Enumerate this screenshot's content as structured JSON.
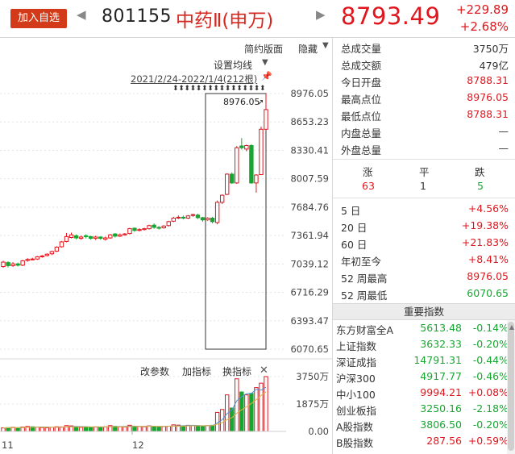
{
  "header": {
    "add_button": "加入自选",
    "prev_arrow": "◀",
    "next_arrow": "▶",
    "code": "801155",
    "name": "中药Ⅱ(申万)",
    "price": "8793.49",
    "change_abs": "+229.89",
    "change_pct": "+2.68%"
  },
  "chart": {
    "simple_layout": "简约版面",
    "hide": "隐藏",
    "set_ma": "设置均线",
    "date_range": "2021/2/24-2022/1/4(212根)",
    "max_marker": "8976.05",
    "y_ticks": [
      "8976.05",
      "8653.23",
      "8330.41",
      "8007.59",
      "7684.76",
      "7361.94",
      "7039.12",
      "6716.29",
      "6393.47",
      "6070.65"
    ],
    "vol_toolbar": {
      "params": "改参数",
      "indicator": "加指标",
      "switch": "换指标",
      "close": "✕"
    },
    "vol_ticks": [
      "3750万",
      "1875万",
      "0.00"
    ],
    "x_ticks": [
      "11",
      "12"
    ]
  },
  "chart_data": {
    "type": "candlestick",
    "ylim": [
      6070.65,
      8976.05
    ],
    "candles": [
      {
        "o": 7010,
        "c": 7060,
        "h": 7075,
        "l": 6995
      },
      {
        "o": 7055,
        "c": 7020,
        "h": 7070,
        "l": 7000
      },
      {
        "o": 7020,
        "c": 7040,
        "h": 7060,
        "l": 7005
      },
      {
        "o": 7040,
        "c": 7025,
        "h": 7055,
        "l": 7010
      },
      {
        "o": 7025,
        "c": 7075,
        "h": 7085,
        "l": 7015
      },
      {
        "o": 7080,
        "c": 7090,
        "h": 7105,
        "l": 7065
      },
      {
        "o": 7095,
        "c": 7095,
        "h": 7110,
        "l": 7080
      },
      {
        "o": 7095,
        "c": 7120,
        "h": 7130,
        "l": 7085
      },
      {
        "o": 7125,
        "c": 7130,
        "h": 7140,
        "l": 7110
      },
      {
        "o": 7135,
        "c": 7150,
        "h": 7160,
        "l": 7125
      },
      {
        "o": 7155,
        "c": 7180,
        "h": 7190,
        "l": 7140
      },
      {
        "o": 7185,
        "c": 7230,
        "h": 7240,
        "l": 7175
      },
      {
        "o": 7235,
        "c": 7290,
        "h": 7300,
        "l": 7225
      },
      {
        "o": 7295,
        "c": 7350,
        "h": 7390,
        "l": 7285
      },
      {
        "o": 7340,
        "c": 7370,
        "h": 7395,
        "l": 7330
      },
      {
        "o": 7360,
        "c": 7335,
        "h": 7375,
        "l": 7320
      },
      {
        "o": 7330,
        "c": 7345,
        "h": 7360,
        "l": 7315
      },
      {
        "o": 7360,
        "c": 7350,
        "h": 7375,
        "l": 7330
      },
      {
        "o": 7350,
        "c": 7330,
        "h": 7360,
        "l": 7315
      },
      {
        "o": 7330,
        "c": 7345,
        "h": 7360,
        "l": 7310
      },
      {
        "o": 7345,
        "c": 7330,
        "h": 7355,
        "l": 7315
      },
      {
        "o": 7320,
        "c": 7335,
        "h": 7350,
        "l": 7305
      },
      {
        "o": 7335,
        "c": 7370,
        "h": 7380,
        "l": 7325
      },
      {
        "o": 7380,
        "c": 7355,
        "h": 7390,
        "l": 7340
      },
      {
        "o": 7355,
        "c": 7370,
        "h": 7385,
        "l": 7345
      },
      {
        "o": 7370,
        "c": 7380,
        "h": 7390,
        "l": 7360
      },
      {
        "o": 7385,
        "c": 7440,
        "h": 7450,
        "l": 7375
      },
      {
        "o": 7445,
        "c": 7420,
        "h": 7455,
        "l": 7405
      },
      {
        "o": 7420,
        "c": 7430,
        "h": 7445,
        "l": 7410
      },
      {
        "o": 7430,
        "c": 7440,
        "h": 7450,
        "l": 7420
      },
      {
        "o": 7440,
        "c": 7475,
        "h": 7485,
        "l": 7430
      },
      {
        "o": 7480,
        "c": 7455,
        "h": 7500,
        "l": 7440
      },
      {
        "o": 7455,
        "c": 7445,
        "h": 7470,
        "l": 7430
      },
      {
        "o": 7450,
        "c": 7470,
        "h": 7480,
        "l": 7440
      },
      {
        "o": 7475,
        "c": 7520,
        "h": 7530,
        "l": 7465
      },
      {
        "o": 7525,
        "c": 7560,
        "h": 7575,
        "l": 7515
      },
      {
        "o": 7565,
        "c": 7570,
        "h": 7590,
        "l": 7550
      },
      {
        "o": 7570,
        "c": 7560,
        "h": 7590,
        "l": 7545
      },
      {
        "o": 7560,
        "c": 7585,
        "h": 7595,
        "l": 7550
      },
      {
        "o": 7590,
        "c": 7600,
        "h": 7610,
        "l": 7575
      },
      {
        "o": 7595,
        "c": 7565,
        "h": 7610,
        "l": 7550
      },
      {
        "o": 7565,
        "c": 7540,
        "h": 7575,
        "l": 7520
      },
      {
        "o": 7540,
        "c": 7560,
        "h": 7570,
        "l": 7530
      },
      {
        "o": 7560,
        "c": 7520,
        "h": 7575,
        "l": 7500
      },
      {
        "o": 7510,
        "c": 7740,
        "h": 7760,
        "l": 7490
      },
      {
        "o": 7740,
        "c": 7820,
        "h": 7830,
        "l": 7720
      },
      {
        "o": 7830,
        "c": 8060,
        "h": 8070,
        "l": 7820
      },
      {
        "o": 8060,
        "c": 7960,
        "h": 8080,
        "l": 7950
      },
      {
        "o": 7960,
        "c": 8360,
        "h": 8380,
        "l": 7950
      },
      {
        "o": 8380,
        "c": 8360,
        "h": 8470,
        "l": 8340
      },
      {
        "o": 8345,
        "c": 8385,
        "h": 8395,
        "l": 8320
      },
      {
        "o": 8385,
        "c": 7960,
        "h": 8400,
        "l": 7950
      },
      {
        "o": 7960,
        "c": 8050,
        "h": 8060,
        "l": 7850
      },
      {
        "o": 8055,
        "c": 8570,
        "h": 8600,
        "l": 8050
      },
      {
        "o": 8570,
        "c": 8793.49,
        "h": 8976.05,
        "l": 8560
      }
    ],
    "volumes": [
      {
        "v": 240,
        "up": true
      },
      {
        "v": 260,
        "up": false
      },
      {
        "v": 280,
        "up": true
      },
      {
        "v": 250,
        "up": false
      },
      {
        "v": 300,
        "up": true
      },
      {
        "v": 340,
        "up": true
      },
      {
        "v": 320,
        "up": false
      },
      {
        "v": 300,
        "up": true
      },
      {
        "v": 260,
        "up": true
      },
      {
        "v": 250,
        "up": true
      },
      {
        "v": 280,
        "up": true
      },
      {
        "v": 320,
        "up": true
      },
      {
        "v": 310,
        "up": true
      },
      {
        "v": 400,
        "up": true
      },
      {
        "v": 380,
        "up": true
      },
      {
        "v": 300,
        "up": false
      },
      {
        "v": 280,
        "up": true
      },
      {
        "v": 300,
        "up": false
      },
      {
        "v": 290,
        "up": false
      },
      {
        "v": 310,
        "up": true
      },
      {
        "v": 300,
        "up": false
      },
      {
        "v": 310,
        "up": true
      },
      {
        "v": 400,
        "up": true
      },
      {
        "v": 350,
        "up": false
      },
      {
        "v": 320,
        "up": true
      },
      {
        "v": 300,
        "up": true
      },
      {
        "v": 420,
        "up": true
      },
      {
        "v": 360,
        "up": false
      },
      {
        "v": 340,
        "up": true
      },
      {
        "v": 320,
        "up": true
      },
      {
        "v": 380,
        "up": true
      },
      {
        "v": 350,
        "up": false
      },
      {
        "v": 330,
        "up": false
      },
      {
        "v": 340,
        "up": true
      },
      {
        "v": 360,
        "up": true
      },
      {
        "v": 450,
        "up": true
      },
      {
        "v": 430,
        "up": true
      },
      {
        "v": 380,
        "up": false
      },
      {
        "v": 420,
        "up": true
      },
      {
        "v": 410,
        "up": true
      },
      {
        "v": 390,
        "up": false
      },
      {
        "v": 370,
        "up": false
      },
      {
        "v": 400,
        "up": true
      },
      {
        "v": 420,
        "up": false
      },
      {
        "v": 1300,
        "up": true
      },
      {
        "v": 1500,
        "up": true
      },
      {
        "v": 2500,
        "up": true
      },
      {
        "v": 1600,
        "up": false
      },
      {
        "v": 3600,
        "up": true
      },
      {
        "v": 2700,
        "up": false
      },
      {
        "v": 2500,
        "up": true
      },
      {
        "v": 2600,
        "up": false
      },
      {
        "v": 3000,
        "up": true
      },
      {
        "v": 3300,
        "up": true
      },
      {
        "v": 3750,
        "up": true
      }
    ],
    "vol_ylim": [
      0,
      3750
    ]
  },
  "quote": [
    {
      "label": "总成交量",
      "value": "3750万",
      "color": "#333333"
    },
    {
      "label": "总成交额",
      "value": "479亿",
      "color": "#333333"
    },
    {
      "label": "今日开盘",
      "value": "8788.31",
      "color": "#e0161e"
    },
    {
      "label": "最高点位",
      "value": "8976.05",
      "color": "#e0161e"
    },
    {
      "label": "最低点位",
      "value": "8788.31",
      "color": "#e0161e"
    },
    {
      "label": "内盘总量",
      "value": "—",
      "color": "#333333"
    },
    {
      "label": "外盘总量",
      "value": "—",
      "color": "#333333"
    }
  ],
  "breadth": {
    "up_label": "涨",
    "flat_label": "平",
    "down_label": "跌",
    "up": "63",
    "flat": "1",
    "down": "5"
  },
  "performance": [
    {
      "label": "5 日",
      "value": "+4.56%",
      "color": "#e0161e"
    },
    {
      "label": "20 日",
      "value": "+19.38%",
      "color": "#e0161e"
    },
    {
      "label": "60 日",
      "value": "+21.83%",
      "color": "#e0161e"
    },
    {
      "label": "年初至今",
      "value": "+8.41%",
      "color": "#e0161e"
    },
    {
      "label": "52 周最高",
      "value": "8976.05",
      "color": "#e0161e"
    },
    {
      "label": "52 周最低",
      "value": "6070.65",
      "color": "#17a631"
    }
  ],
  "indices_header": "重要指数",
  "indices": [
    {
      "name": "东方财富全A",
      "price": "5613.48",
      "change": "-0.14%",
      "color": "#17a631"
    },
    {
      "name": "上证指数",
      "price": "3632.33",
      "change": "-0.20%",
      "color": "#17a631"
    },
    {
      "name": "深证成指",
      "price": "14791.31",
      "change": "-0.44%",
      "color": "#17a631"
    },
    {
      "name": "沪深300",
      "price": "4917.77",
      "change": "-0.46%",
      "color": "#17a631"
    },
    {
      "name": "中小100",
      "price": "9994.21",
      "change": "+0.08%",
      "color": "#e0161e"
    },
    {
      "name": "创业板指",
      "price": "3250.16",
      "change": "-2.18%",
      "color": "#17a631"
    },
    {
      "name": "A股指数",
      "price": "3806.50",
      "change": "-0.20%",
      "color": "#17a631"
    },
    {
      "name": "B股指数",
      "price": "287.56",
      "change": "+0.59%",
      "color": "#e0161e"
    }
  ],
  "colors": {
    "up": "#e0161e",
    "down": "#17a631",
    "brand": "#d23a19"
  }
}
